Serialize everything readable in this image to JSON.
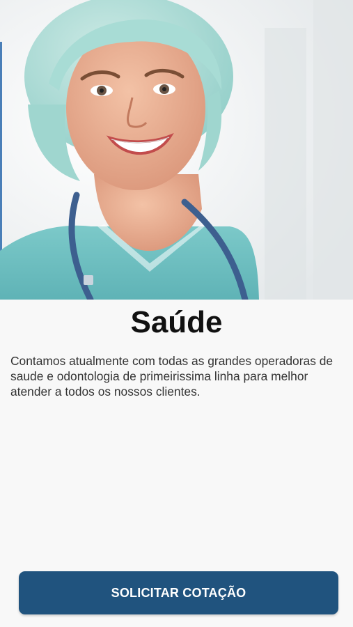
{
  "hero": {
    "image": "smiling-nurse-photo"
  },
  "page": {
    "title": "Saúde",
    "description": "Contamos atualmente com todas as grandes operadoras de saude e odontologia de primeirissima linha para melhor atender a todos os nossos clientes."
  },
  "actions": {
    "primary_label": "SOLICITAR COTAÇÃO"
  },
  "colors": {
    "primary": "#20537e",
    "background": "#f8f8f8",
    "title": "#111111",
    "body_text": "#333333"
  }
}
